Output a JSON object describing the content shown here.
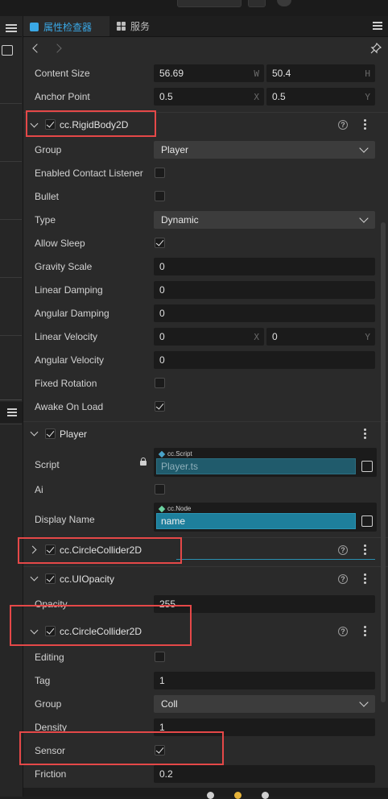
{
  "tabs": {
    "inspector_label": "属性检查器",
    "services_label": "服务"
  },
  "transform": {
    "content_size": {
      "label": "Content Size",
      "w": "56.69",
      "w_suffix": "W",
      "h": "50.4",
      "h_suffix": "H"
    },
    "anchor_point": {
      "label": "Anchor Point",
      "x": "0.5",
      "x_suffix": "X",
      "y": "0.5",
      "y_suffix": "Y"
    }
  },
  "rigidbody": {
    "title": "cc.RigidBody2D",
    "rows": {
      "group": {
        "label": "Group",
        "value": "Player"
      },
      "enabled_contact_listener": {
        "label": "Enabled Contact Listener",
        "checked": false
      },
      "bullet": {
        "label": "Bullet",
        "checked": false
      },
      "type": {
        "label": "Type",
        "value": "Dynamic"
      },
      "allow_sleep": {
        "label": "Allow Sleep",
        "checked": true
      },
      "gravity_scale": {
        "label": "Gravity Scale",
        "value": "0"
      },
      "linear_damping": {
        "label": "Linear Damping",
        "value": "0"
      },
      "angular_damping": {
        "label": "Angular Damping",
        "value": "0"
      },
      "linear_velocity": {
        "label": "Linear Velocity",
        "x": "0",
        "x_suffix": "X",
        "y": "0",
        "y_suffix": "Y"
      },
      "angular_velocity": {
        "label": "Angular Velocity",
        "value": "0"
      },
      "fixed_rotation": {
        "label": "Fixed Rotation",
        "checked": false
      },
      "awake_on_load": {
        "label": "Awake On Load",
        "checked": true
      }
    }
  },
  "player": {
    "title": "Player",
    "script": {
      "label": "Script",
      "tag": "cc.Script",
      "value": "Player.ts"
    },
    "ai": {
      "label": "Ai",
      "checked": false
    },
    "display_name": {
      "label": "Display Name",
      "tag": "cc.Node",
      "value": "name"
    }
  },
  "circle_collider_collapsed": {
    "title": "cc.CircleCollider2D"
  },
  "ui_opacity": {
    "title": "cc.UIOpacity",
    "opacity_label": "Opacity",
    "opacity_value": "255"
  },
  "circle_collider": {
    "title": "cc.CircleCollider2D",
    "rows": {
      "editing": {
        "label": "Editing",
        "checked": false
      },
      "tag": {
        "label": "Tag",
        "value": "1"
      },
      "group": {
        "label": "Group",
        "value": "Coll"
      },
      "density": {
        "label": "Density",
        "value": "1"
      },
      "sensor": {
        "label": "Sensor",
        "checked": true
      },
      "friction": {
        "label": "Friction",
        "value": "0.2"
      }
    }
  },
  "icons": [
    "cube-icon",
    "grid-icon",
    "hamburger-icon",
    "back-icon",
    "forward-icon",
    "pin-icon",
    "help-icon",
    "kebab-icon",
    "pick-icon"
  ],
  "colors": {
    "accent": "#3aa8e6",
    "highlight_red": "#e54848",
    "node_field": "#1e7f9c"
  }
}
